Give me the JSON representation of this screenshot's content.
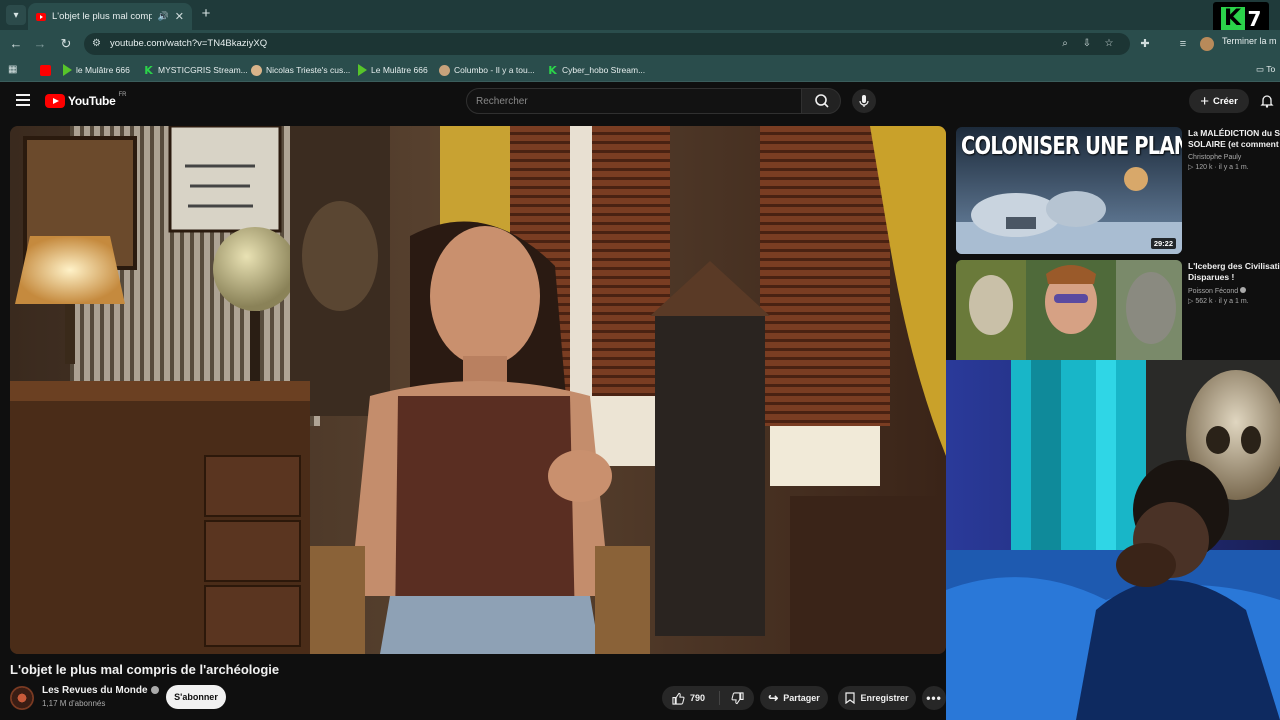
{
  "browser": {
    "tab": {
      "title": "L'objet le plus mal compris"
    },
    "url": "youtube.com/watch?v=TN4BkaziyXQ",
    "finish_label": "Terminer la m",
    "overlay_badge": {
      "letter": "K",
      "number": "7"
    },
    "bookmarks": [
      {
        "label": "",
        "icon": "youtube-icon"
      },
      {
        "label": "le Mulâtre 666",
        "icon": "play-icon"
      },
      {
        "label": "MYSTICGRIS Stream...",
        "icon": "kick-icon"
      },
      {
        "label": "Nicolas Trieste's cus...",
        "icon": "cat-icon"
      },
      {
        "label": "Le Mulâtre 666",
        "icon": "play-icon"
      },
      {
        "label": "Columbo - Il y a tou...",
        "icon": "columbo-icon"
      },
      {
        "label": "Cyber_hobo Stream...",
        "icon": "kick-icon"
      }
    ],
    "all_bookmarks_label": "To"
  },
  "youtube": {
    "logo_text": "YouTube",
    "country_code": "FR",
    "search_placeholder": "Rechercher",
    "create_label": "Créer"
  },
  "video": {
    "title": "L'objet le plus mal compris de l'archéologie",
    "channel": "Les Revues du Monde",
    "subscribers": "1,17 M d'abonnés",
    "subscribe_label": "S'abonner",
    "likes": "790",
    "share_label": "Partager",
    "save_label": "Enregistrer"
  },
  "related": [
    {
      "title_line1": "La MALÉDICTION du SY",
      "title_line2": "SOLAIRE (et comment l",
      "channel": "Christophe Pauly",
      "stats": "120 k · il y a 1 m.",
      "duration": "29:22",
      "thumb_text": "COLONISER UNE PLANÈTE"
    },
    {
      "title_line1": "L'Iceberg des Civilisatio",
      "title_line2": "Disparues !",
      "channel": "Poisson Fécond",
      "stats": "562 k · il y a 1 m."
    }
  ]
}
